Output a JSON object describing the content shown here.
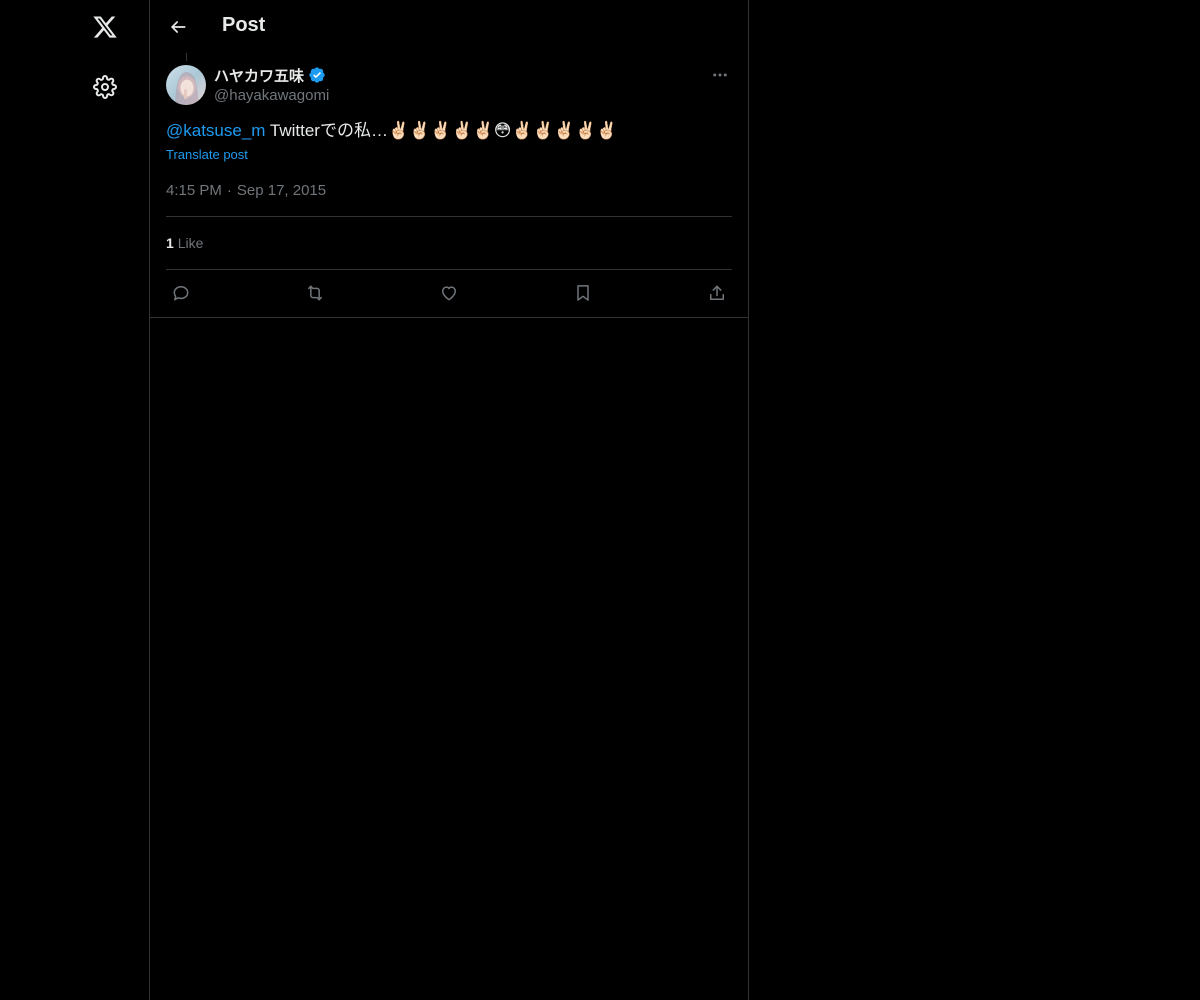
{
  "nav": {
    "logo_icon": "x-logo-icon",
    "settings_icon": "gear-icon"
  },
  "header": {
    "title": "Post",
    "back_icon": "arrow-left-icon"
  },
  "tweet": {
    "author": {
      "display_name": "ハヤカワ五味",
      "handle": "@hayakawagomi",
      "verified": true
    },
    "text": {
      "mention": "@katsuse_m",
      "body": " Twitterでの私…✌🏻✌🏻✌🏻✌🏻✌🏻😳✌🏻✌🏻✌🏻✌🏻✌🏻"
    },
    "translate_label": "Translate post",
    "time": "4:15 PM",
    "separator": "·",
    "date": "Sep 17, 2015",
    "stats": {
      "likes_count": "1",
      "likes_label": "Like"
    }
  },
  "colors": {
    "background": "#000000",
    "accent": "#1d9bf0",
    "text_primary": "#e7e9ea",
    "text_secondary": "#71767b",
    "border": "#2f3336"
  }
}
